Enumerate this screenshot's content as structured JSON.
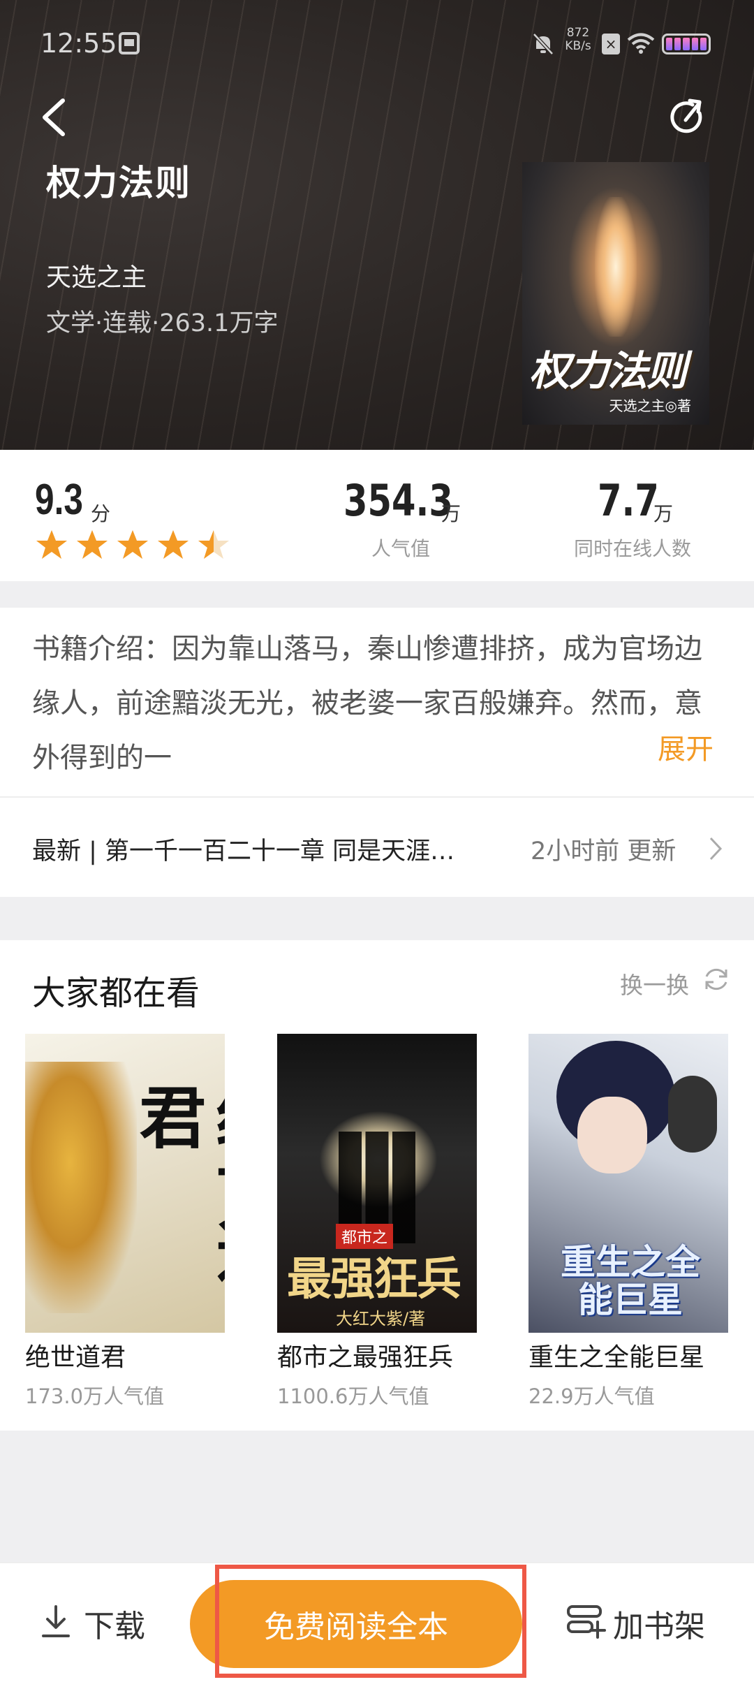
{
  "status_bar": {
    "time": "12:55",
    "net_speed_value": "872",
    "net_speed_unit": "KB/s"
  },
  "book": {
    "title": "权力法则",
    "author": "天选之主",
    "meta": "文学·连载·263.1万字",
    "cover_title": "权力法则",
    "cover_author": "天选之主◎著"
  },
  "stats": {
    "score": "9.3",
    "score_unit": "分",
    "rating_stars": 4.5,
    "popularity": "354.3",
    "popularity_unit": "万",
    "popularity_label": "人气值",
    "online": "7.7",
    "online_unit": "万",
    "online_label": "同时在线人数"
  },
  "intro": {
    "text": "书籍介绍：因为靠山落马，秦山惨遭排挤，成为官场边缘人，前途黯淡无光，被老婆一家百般嫌弃。然而，意外得到的一",
    "expand_label": "展开"
  },
  "latest": {
    "text": "最新 | 第一千一百二十一章 同是天涯…",
    "time": "2小时前 更新"
  },
  "recommendations": {
    "title": "大家都在看",
    "swap_label": "换一换",
    "items": [
      {
        "name": "绝世道君",
        "popularity": "173.0万人气值",
        "cover_text": "绝世道君"
      },
      {
        "name": "都市之最强狂兵",
        "popularity": "1100.6万人气值",
        "cover_prefix": "都市之",
        "cover_text": "最强狂兵",
        "cover_author": "大红大紫/著"
      },
      {
        "name": "重生之全能巨星",
        "popularity": "22.9万人气值",
        "cover_text": "重生之全能巨星"
      }
    ]
  },
  "bottom_bar": {
    "download_label": "下载",
    "read_label": "免费阅读全本",
    "shelf_label": "加书架"
  },
  "colors": {
    "accent": "#f39a25",
    "highlight_border": "#ee5846",
    "star": "#f39a25"
  }
}
